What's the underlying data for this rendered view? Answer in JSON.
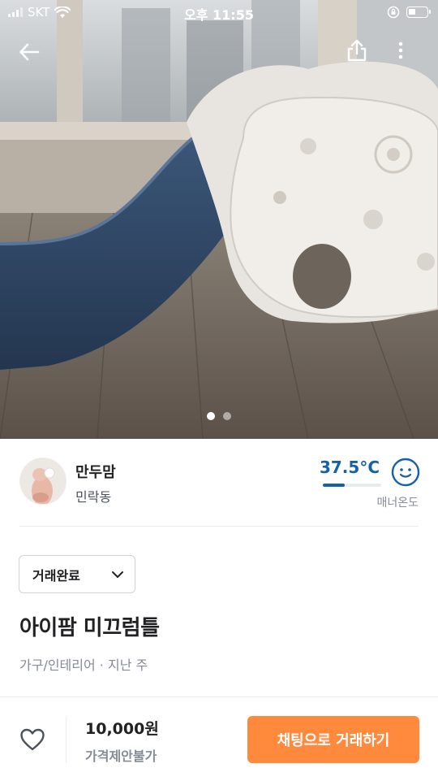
{
  "status_bar": {
    "carrier": "SKT",
    "time": "오후 11:55"
  },
  "hero": {
    "image_count": 2,
    "active_index": 0
  },
  "seller": {
    "nickname": "만두맘",
    "region": "민락동",
    "temperature": "37.5°C",
    "temperature_value": 37.5,
    "temperature_label": "매너온도"
  },
  "item": {
    "trade_status": "거래완료",
    "title": "아이팜 미끄럼틀",
    "meta": "가구/인테리어 · 지난 주"
  },
  "bottom": {
    "price": "10,000원",
    "negotiation": "가격제안불가",
    "chat_button": "채팅으로 거래하기"
  },
  "colors": {
    "accent_orange": "#ff8a3d",
    "temperature_blue": "#1561a9"
  },
  "icons": {
    "back": "arrow-left-icon",
    "share": "share-icon",
    "more": "more-vertical-icon",
    "like": "heart-icon",
    "manner": "smile-face-icon",
    "dropdown": "chevron-down-icon"
  }
}
